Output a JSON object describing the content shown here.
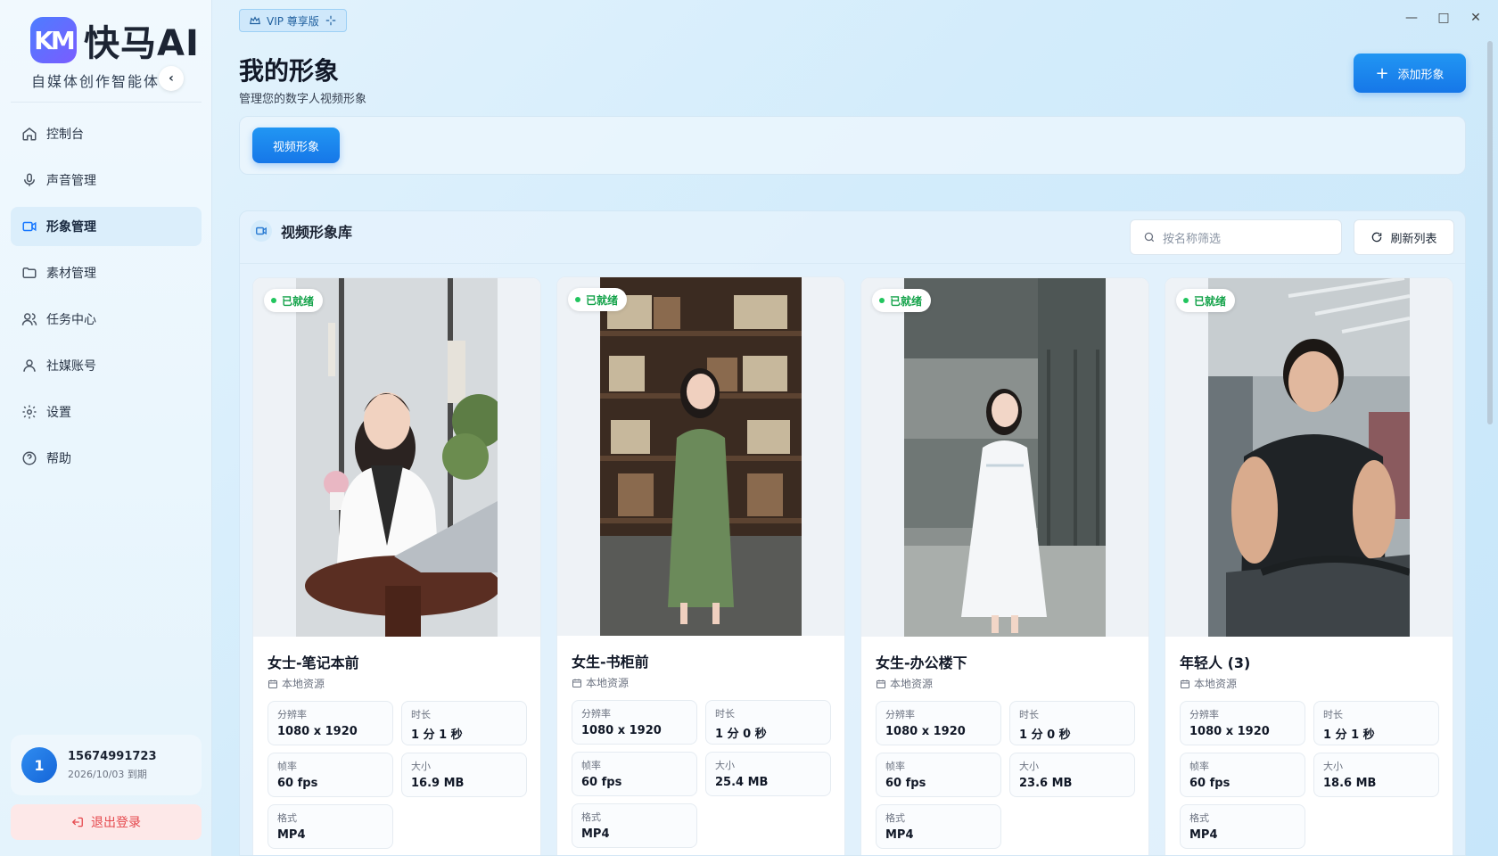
{
  "app": {
    "logo_mark": "KM",
    "name": "快马AI",
    "subtitle": "自媒体创作智能体",
    "vip_label": "VIP 尊享版"
  },
  "sidebar": {
    "items": [
      {
        "label": "控制台",
        "icon": "home-icon",
        "active": false
      },
      {
        "label": "声音管理",
        "icon": "mic-icon",
        "active": false
      },
      {
        "label": "形象管理",
        "icon": "video-icon",
        "active": true
      },
      {
        "label": "素材管理",
        "icon": "folder-icon",
        "active": false
      },
      {
        "label": "任务中心",
        "icon": "users-icon",
        "active": false
      },
      {
        "label": "社媒账号",
        "icon": "user-icon",
        "active": false
      },
      {
        "label": "设置",
        "icon": "gear-icon",
        "active": false
      },
      {
        "label": "帮助",
        "icon": "help-icon",
        "active": false
      }
    ],
    "user": {
      "avatar_text": "1",
      "phone": "15674991723",
      "expiry": "2026/10/03 到期"
    },
    "logout_label": "退出登录"
  },
  "header": {
    "title": "我的形象",
    "description": "管理您的数字人视频形象",
    "add_button": "添加形象"
  },
  "filter": {
    "tab_label": "视频形象"
  },
  "library": {
    "title": "视频形象库",
    "search_placeholder": "按名称筛选",
    "refresh_label": "刷新列表",
    "cards": [
      {
        "status": "已就绪",
        "title": "女士-笔记本前",
        "source": "本地资源",
        "meta": [
          {
            "k": "分辨率",
            "v": "1080 x 1920"
          },
          {
            "k": "时长",
            "v": "1 分 1 秒"
          },
          {
            "k": "帧率",
            "v": "60 fps"
          },
          {
            "k": "大小",
            "v": "16.9 MB"
          },
          {
            "k": "格式",
            "v": "MP4"
          }
        ]
      },
      {
        "status": "已就绪",
        "title": "女生-书柜前",
        "source": "本地资源",
        "meta": [
          {
            "k": "分辨率",
            "v": "1080 x 1920"
          },
          {
            "k": "时长",
            "v": "1 分 0 秒"
          },
          {
            "k": "帧率",
            "v": "60 fps"
          },
          {
            "k": "大小",
            "v": "25.4 MB"
          },
          {
            "k": "格式",
            "v": "MP4"
          }
        ]
      },
      {
        "status": "已就绪",
        "title": "女生-办公楼下",
        "source": "本地资源",
        "meta": [
          {
            "k": "分辨率",
            "v": "1080 x 1920"
          },
          {
            "k": "时长",
            "v": "1 分 0 秒"
          },
          {
            "k": "帧率",
            "v": "60 fps"
          },
          {
            "k": "大小",
            "v": "23.6 MB"
          },
          {
            "k": "格式",
            "v": "MP4"
          }
        ]
      },
      {
        "status": "已就绪",
        "title": "年轻人 (3)",
        "source": "本地资源",
        "meta": [
          {
            "k": "分辨率",
            "v": "1080 x 1920"
          },
          {
            "k": "时长",
            "v": "1 分 1 秒"
          },
          {
            "k": "帧率",
            "v": "60 fps"
          },
          {
            "k": "大小",
            "v": "18.6 MB"
          },
          {
            "k": "格式",
            "v": "MP4"
          }
        ]
      }
    ]
  },
  "colors": {
    "accent": "#1677e8",
    "success": "#22c55e",
    "danger": "#e5484d"
  }
}
